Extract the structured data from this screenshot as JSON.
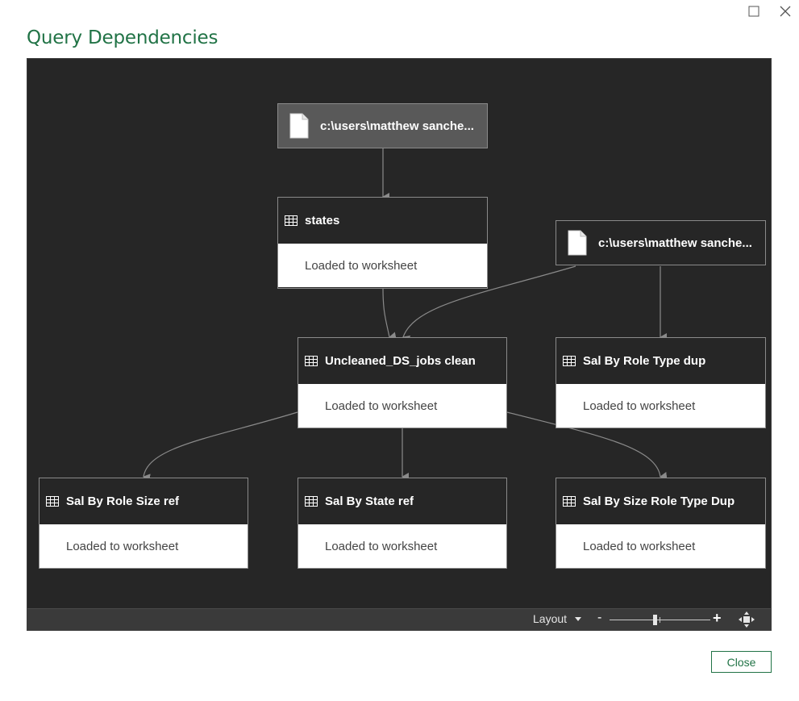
{
  "window": {
    "title": "Query Dependencies",
    "maximize_icon": "maximize-icon",
    "close_icon": "close-icon"
  },
  "nodes": {
    "source1": {
      "label": "c:\\users\\matthew sanche...",
      "icon": "document-icon"
    },
    "states": {
      "label": "states",
      "status": "Loaded to worksheet",
      "icon": "table-icon"
    },
    "source2": {
      "label": "c:\\users\\matthew sanche...",
      "icon": "document-icon"
    },
    "uncleaned": {
      "label": "Uncleaned_DS_jobs clean",
      "status": "Loaded to worksheet",
      "icon": "table-icon"
    },
    "role_type_dup": {
      "label": "Sal By Role Type dup",
      "status": "Loaded to worksheet",
      "icon": "table-icon"
    },
    "role_size_ref": {
      "label": "Sal By Role Size ref",
      "status": "Loaded to worksheet",
      "icon": "table-icon"
    },
    "state_ref": {
      "label": "Sal By State ref",
      "status": "Loaded to worksheet",
      "icon": "table-icon"
    },
    "size_role_type_dup": {
      "label": "Sal By Size Role Type Dup",
      "status": "Loaded to worksheet",
      "icon": "table-icon"
    }
  },
  "statusbar": {
    "layout_label": "Layout",
    "zoom_minus": "-",
    "zoom_plus": "+",
    "zoom_level": 0.45
  },
  "footer": {
    "close_label": "Close"
  },
  "colors": {
    "accent": "#217346",
    "canvas": "#262626",
    "source_node": "#595959",
    "edge": "#8a8a8a"
  }
}
